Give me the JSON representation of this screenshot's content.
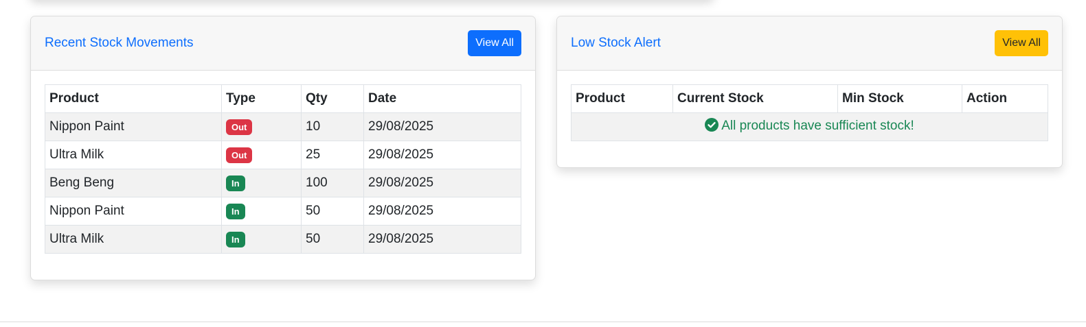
{
  "movements": {
    "title": "Recent Stock Movements",
    "view_all_label": "View All",
    "columns": [
      "Product",
      "Type",
      "Qty",
      "Date"
    ],
    "rows": [
      {
        "product": "Nippon Paint",
        "type": "Out",
        "qty": "10",
        "date": "29/08/2025"
      },
      {
        "product": "Ultra Milk",
        "type": "Out",
        "qty": "25",
        "date": "29/08/2025"
      },
      {
        "product": "Beng Beng",
        "type": "In",
        "qty": "100",
        "date": "29/08/2025"
      },
      {
        "product": "Nippon Paint",
        "type": "In",
        "qty": "50",
        "date": "29/08/2025"
      },
      {
        "product": "Ultra Milk",
        "type": "In",
        "qty": "50",
        "date": "29/08/2025"
      }
    ]
  },
  "low_stock": {
    "title": "Low Stock Alert",
    "view_all_label": "View All",
    "columns": [
      "Product",
      "Current Stock",
      "Min Stock",
      "Action"
    ],
    "empty_message": "All products have sufficient stock!",
    "empty_icon": "check-circle-icon"
  },
  "colors": {
    "primary": "#0d6efd",
    "warning": "#ffc107",
    "danger": "#dc3545",
    "success": "#198754"
  }
}
